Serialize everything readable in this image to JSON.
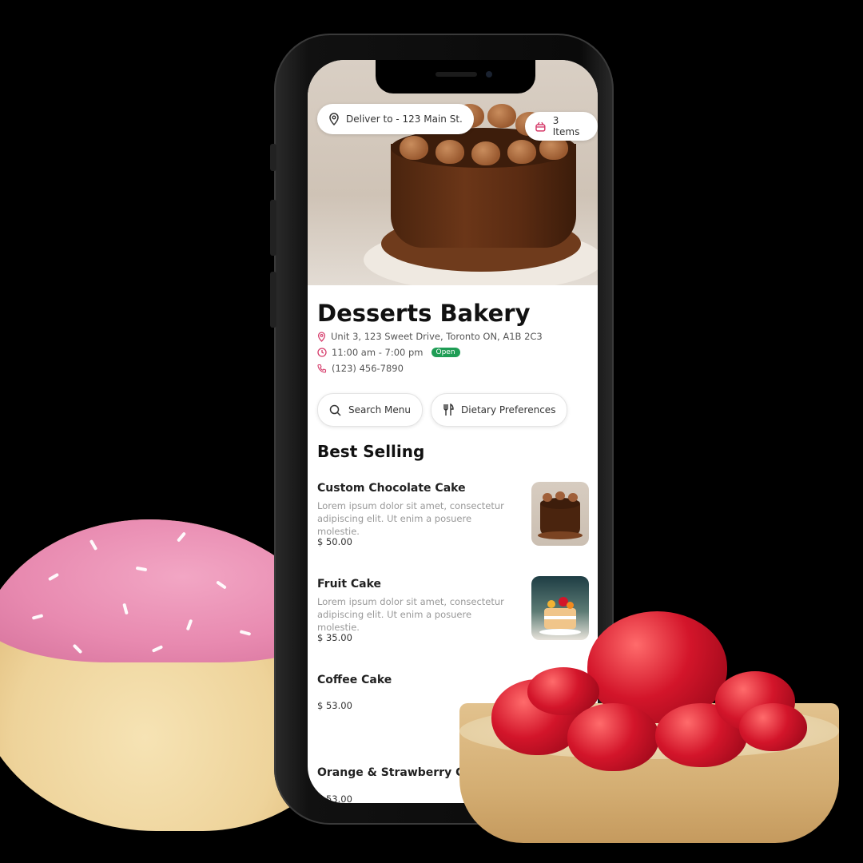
{
  "header": {
    "deliver_label": "Deliver to - 123 Main St.",
    "cart_label": "3 Items"
  },
  "store": {
    "name": "Desserts Bakery",
    "address": "Unit 3, 123 Sweet Drive, Toronto ON, A1B 2C3",
    "hours": "11:00 am - 7:00 pm",
    "status": "Open",
    "phone": "(123) 456-7890"
  },
  "actions": {
    "search_label": "Search Menu",
    "dietary_label": "Dietary Preferences"
  },
  "menu": {
    "section_title": "Best Selling",
    "items": [
      {
        "name": "Custom Chocolate Cake",
        "description": "Lorem ipsum dolor sit amet, consectetur adipiscing elit. Ut enim a posuere molestie.",
        "price": "$ 50.00"
      },
      {
        "name": "Fruit Cake",
        "description": "Lorem ipsum dolor sit amet, consectetur adipiscing elit. Ut enim a posuere molestie.",
        "price": "$ 35.00"
      },
      {
        "name": "Coffee Cake",
        "description": "",
        "price": "$ 53.00"
      },
      {
        "name": "Orange & Strawberry Cake",
        "description": "",
        "price": "$ 53.00"
      }
    ]
  },
  "colors": {
    "accent": "#d63c6b",
    "open_badge": "#1f9d55",
    "text_primary": "#111111",
    "text_muted": "#999999"
  },
  "icons": {
    "location": "location-pin-icon",
    "cart": "basket-icon",
    "clock": "clock-icon",
    "phone": "phone-icon",
    "search": "search-icon",
    "dietary": "fork-knife-icon"
  }
}
